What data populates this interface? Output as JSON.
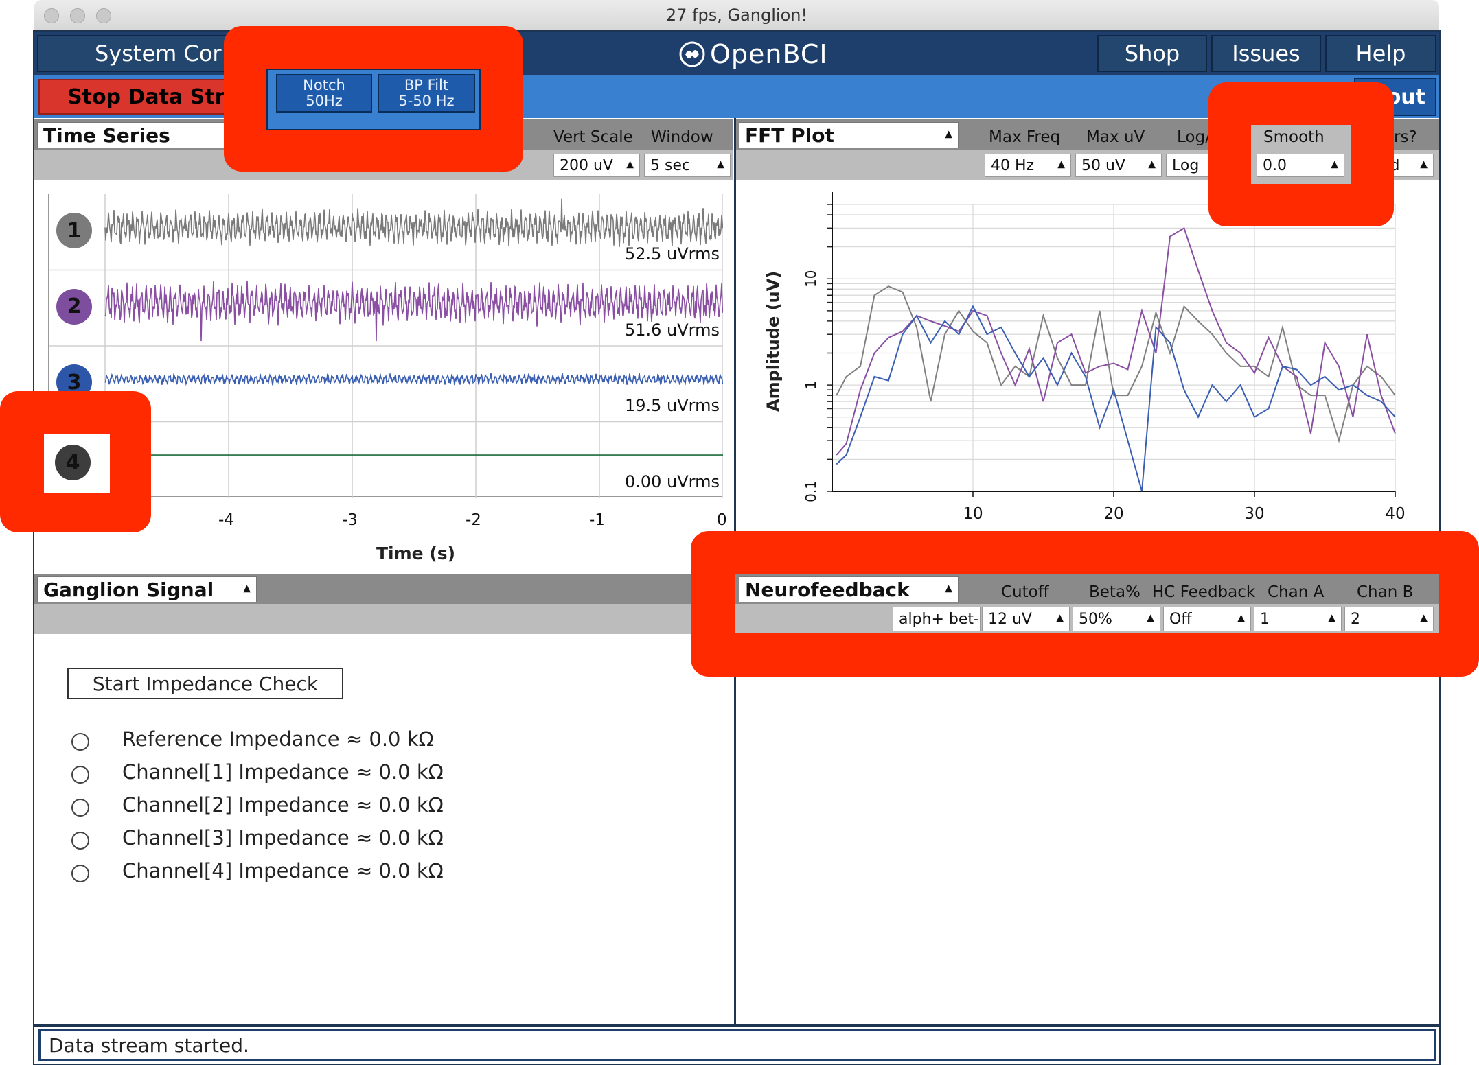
{
  "window": {
    "title": "27 fps, Ganglion!"
  },
  "navbar": {
    "system_control": "System Cor",
    "logo": "OpenBCI",
    "shop": "Shop",
    "issues": "Issues",
    "help": "Help"
  },
  "toolbar": {
    "stop_stream": "Stop Data Strean",
    "notch_line1": "Notch",
    "notch_line2": "50Hz",
    "bp_line1": "BP Filt",
    "bp_line2": "5-50 Hz",
    "layout": "out"
  },
  "time_series": {
    "widget_title": "Time Series",
    "vert_scale_label": "Vert Scale",
    "window_label": "Window",
    "vert_scale_value": "200 uV",
    "window_value": "5 sec",
    "x_axis_label": "Time (s)",
    "x_ticks": [
      "-4",
      "-3",
      "-2",
      "-1",
      "0"
    ],
    "channels": [
      {
        "number": "1",
        "rms": "52.5 uVrms",
        "color": "#7b7b7b",
        "trace": "#7a7a7a"
      },
      {
        "number": "2",
        "rms": "51.6 uVrms",
        "color": "#7d4d9e",
        "trace": "#8a4fa3"
      },
      {
        "number": "3",
        "rms": "19.5 uVrms",
        "color": "#2e56a8",
        "trace": "#3a5fb3"
      },
      {
        "number": "4",
        "rms": "0.00 uVrms",
        "color": "#3d3d3d",
        "trace": "#1a6b3c"
      }
    ]
  },
  "fft": {
    "widget_title": "FFT Plot",
    "max_freq_label": "Max Freq",
    "max_uv_label": "Max uV",
    "log_label": "Log/",
    "smooth_label": "Smooth",
    "filters_label": "rs?",
    "max_freq_value": "40 Hz",
    "max_uv_value": "50 uV",
    "log_value": "Log",
    "smooth_value": "0.0",
    "filters_value": "ed",
    "y_axis_label": "Amplitude (uV)",
    "y_ticks": [
      "10",
      "1",
      "0.1"
    ],
    "x_ticks": [
      "10",
      "20",
      "30",
      "40"
    ]
  },
  "chart_data": {
    "type": "line",
    "title": "",
    "xlabel": "",
    "ylabel": "Amplitude (uV)",
    "xlim": [
      0,
      40
    ],
    "ylim": [
      0.1,
      50
    ],
    "y_scale": "log",
    "grid": true,
    "x": [
      0.3,
      1,
      2,
      3,
      4,
      5,
      6,
      7,
      8,
      9,
      10,
      11,
      12,
      13,
      14,
      15,
      16,
      17,
      18,
      19,
      20,
      21,
      22,
      23,
      24,
      25,
      26,
      27,
      28,
      29,
      30,
      31,
      32,
      33,
      34,
      35,
      36,
      37,
      38,
      39,
      40
    ],
    "series": [
      {
        "color": "#808080",
        "values": [
          0.8,
          1.2,
          1.5,
          7.0,
          8.5,
          7.5,
          3.5,
          0.7,
          3.0,
          5.0,
          3.2,
          2.5,
          1.0,
          1.5,
          1.2,
          4.5,
          1.8,
          1.0,
          1.0,
          5.0,
          0.8,
          0.8,
          1.5,
          4.8,
          2.0,
          5.5,
          4.0,
          3.0,
          2.0,
          1.5,
          1.5,
          1.2,
          3.5,
          1.0,
          0.8,
          0.8,
          0.3,
          1.0,
          1.5,
          1.2,
          0.8
        ]
      },
      {
        "color": "#8a4fa3",
        "values": [
          0.22,
          0.28,
          0.9,
          2.0,
          2.8,
          3.2,
          4.5,
          4.0,
          3.6,
          3.2,
          5.0,
          4.5,
          2.0,
          1.0,
          2.2,
          0.7,
          2.5,
          3.0,
          1.3,
          1.5,
          1.6,
          1.4,
          5.0,
          2.0,
          25.0,
          30.0,
          12.0,
          5.0,
          2.5,
          2.0,
          1.3,
          2.8,
          1.5,
          1.2,
          0.35,
          2.5,
          1.5,
          0.5,
          3.0,
          0.8,
          0.35
        ]
      },
      {
        "color": "#3a5fb3",
        "values": [
          0.18,
          0.22,
          0.5,
          1.2,
          1.1,
          3.0,
          4.5,
          2.5,
          4.0,
          3.0,
          5.5,
          3.0,
          3.5,
          2.0,
          1.2,
          1.8,
          1.0,
          2.0,
          1.2,
          0.4,
          0.9,
          0.3,
          0.1,
          3.5,
          2.5,
          0.9,
          0.5,
          1.0,
          0.7,
          1.0,
          0.5,
          0.6,
          1.5,
          1.4,
          1.0,
          1.2,
          0.9,
          1.0,
          0.8,
          0.7,
          0.5
        ]
      }
    ]
  },
  "ganglion": {
    "widget_title": "Ganglion Signal",
    "impedance_button": "Start Impedance Check",
    "rows": [
      "Reference Impedance ≈ 0.0 kΩ",
      "Channel[1] Impedance ≈ 0.0 kΩ",
      "Channel[2] Impedance ≈ 0.0 kΩ",
      "Channel[3] Impedance ≈ 0.0 kΩ",
      "Channel[4] Impedance ≈ 0.0 kΩ"
    ]
  },
  "neurofeedback": {
    "widget_title": "Neurofeedback",
    "mode_value": "alph+ bet-",
    "cutoff_label": "Cutoff",
    "beta_label": "Beta%",
    "hc_label": "HC Feedback",
    "chan_a_label": "Chan A",
    "chan_b_label": "Chan B",
    "cutoff_value": "12 uV",
    "beta_value": "50%",
    "hc_value": "Off",
    "chan_a_value": "1",
    "chan_b_value": "2"
  },
  "status": {
    "message": "Data stream started."
  }
}
